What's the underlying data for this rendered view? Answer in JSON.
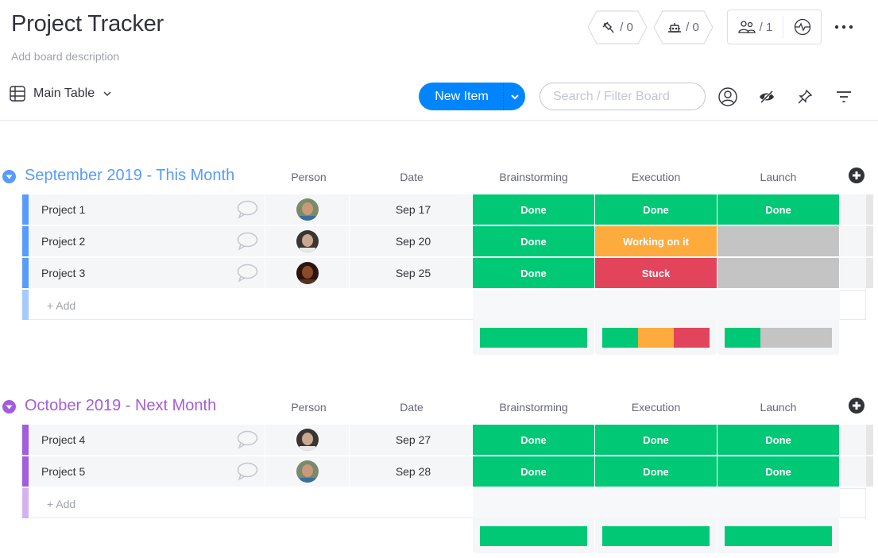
{
  "board": {
    "title": "Project Tracker",
    "description_placeholder": "Add board description"
  },
  "header_widgets": {
    "integrations": {
      "icon": "plug-icon",
      "count": "/ 0"
    },
    "automations": {
      "icon": "robot-icon",
      "count": "/ 0"
    },
    "members": {
      "icon": "people-icon",
      "count": "/ 1"
    },
    "activity": {
      "icon": "activity-icon"
    },
    "more": {
      "icon": "more-dots-icon"
    }
  },
  "toolbar": {
    "view_label": "Main Table",
    "new_item_label": "New Item",
    "search_placeholder": "Search / Filter Board",
    "icons": [
      "person-filter-icon",
      "hide-icon",
      "pin-icon",
      "filter-icon"
    ]
  },
  "columns": {
    "person": "Person",
    "date": "Date",
    "status": [
      "Brainstorming",
      "Execution",
      "Launch"
    ]
  },
  "status_colors": {
    "Done": "#00c875",
    "Working on it": "#fdab3d",
    "Stuck": "#e2445c",
    "": "#c4c4c4"
  },
  "groups": [
    {
      "name": "September 2019 - This Month",
      "color": "#579bfc",
      "add_bar_color": "#a5cafd",
      "add_label": "+ Add",
      "items": [
        {
          "name": "Project 1",
          "person": "avatar-1",
          "date": "Sep 17",
          "status": [
            "Done",
            "Done",
            "Done"
          ]
        },
        {
          "name": "Project 2",
          "person": "avatar-2",
          "date": "Sep 20",
          "status": [
            "Done",
            "Working on it",
            ""
          ]
        },
        {
          "name": "Project 3",
          "person": "avatar-3",
          "date": "Sep 25",
          "status": [
            "Done",
            "Stuck",
            ""
          ]
        }
      ],
      "summary": [
        [
          {
            "status": "Done",
            "fraction": 1.0
          }
        ],
        [
          {
            "status": "Done",
            "fraction": 0.3333
          },
          {
            "status": "Working on it",
            "fraction": 0.3333
          },
          {
            "status": "Stuck",
            "fraction": 0.3334
          }
        ],
        [
          {
            "status": "Done",
            "fraction": 0.3333
          },
          {
            "status": "",
            "fraction": 0.6667
          }
        ]
      ]
    },
    {
      "name": "October 2019 - Next Month",
      "color": "#a25ddc",
      "add_bar_color": "#d4b2f0",
      "add_label": "+ Add",
      "items": [
        {
          "name": "Project 4",
          "person": "avatar-2",
          "date": "Sep 27",
          "status": [
            "Done",
            "Done",
            "Done"
          ]
        },
        {
          "name": "Project 5",
          "person": "avatar-1",
          "date": "Sep 28",
          "status": [
            "Done",
            "Done",
            "Done"
          ]
        }
      ],
      "summary": [
        [
          {
            "status": "Done",
            "fraction": 1.0
          }
        ],
        [
          {
            "status": "Done",
            "fraction": 1.0
          }
        ],
        [
          {
            "status": "Done",
            "fraction": 1.0
          }
        ]
      ]
    }
  ]
}
